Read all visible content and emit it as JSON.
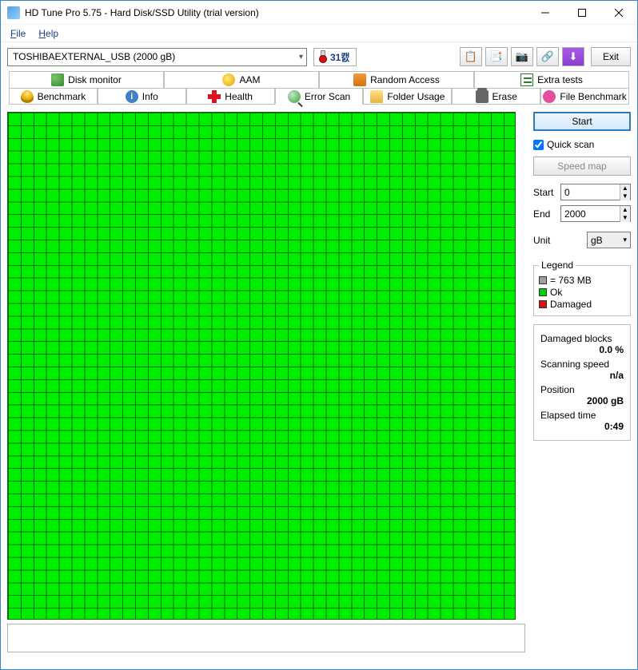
{
  "window": {
    "title": "HD Tune Pro 5.75 - Hard Disk/SSD Utility (trial version)"
  },
  "menu": {
    "file": "File",
    "help": "Help"
  },
  "toolbar": {
    "drive": "TOSHIBAEXTERNAL_USB (2000 gB)",
    "temp": "31캜",
    "exit": "Exit"
  },
  "tabs": {
    "top": [
      "Disk monitor",
      "AAM",
      "Random Access",
      "Extra tests"
    ],
    "bottom": [
      "Benchmark",
      "Info",
      "Health",
      "Error Scan",
      "Folder Usage",
      "Erase",
      "File Benchmark"
    ],
    "active": "Error Scan"
  },
  "controls": {
    "start": "Start",
    "quick_scan": "Quick scan",
    "quick_scan_checked": true,
    "speed_map": "Speed map",
    "start_label": "Start",
    "start_value": "0",
    "end_label": "End",
    "end_value": "2000",
    "unit_label": "Unit",
    "unit_value": "gB"
  },
  "legend": {
    "title": "Legend",
    "block": "= 763 MB",
    "ok": "Ok",
    "damaged": "Damaged"
  },
  "stats": {
    "damaged_label": "Damaged blocks",
    "damaged_value": "0.0 %",
    "speed_label": "Scanning speed",
    "speed_value": "n/a",
    "position_label": "Position",
    "position_value": "2000 gB",
    "elapsed_label": "Elapsed time",
    "elapsed_value": "0:49"
  }
}
